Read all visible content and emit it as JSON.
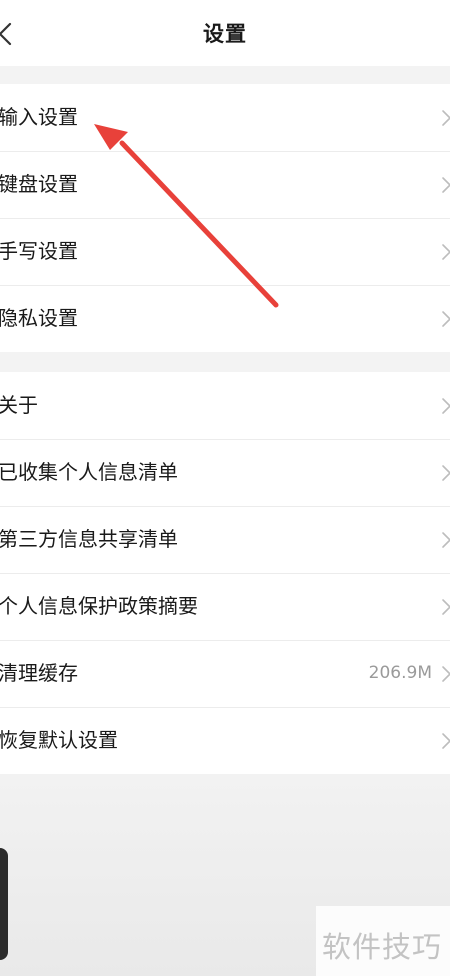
{
  "header": {
    "title": "设置",
    "back_icon": "chevron-left-icon"
  },
  "groups": [
    {
      "items": [
        {
          "label": "输入设置"
        },
        {
          "label": "键盘设置"
        },
        {
          "label": "手写设置"
        },
        {
          "label": "隐私设置"
        }
      ]
    },
    {
      "items": [
        {
          "label": "关于"
        },
        {
          "label": "已收集个人信息清单"
        },
        {
          "label": "第三方信息共享清单"
        },
        {
          "label": "个人信息保护政策摘要"
        },
        {
          "label": "清理缓存",
          "value": "206.9M"
        },
        {
          "label": "恢复默认设置"
        }
      ]
    }
  ],
  "watermark": {
    "text": "软件技巧"
  },
  "colors": {
    "annotation_arrow": "#e8413a",
    "separator": "#ececec",
    "secondary_text": "#9a9a9a"
  }
}
